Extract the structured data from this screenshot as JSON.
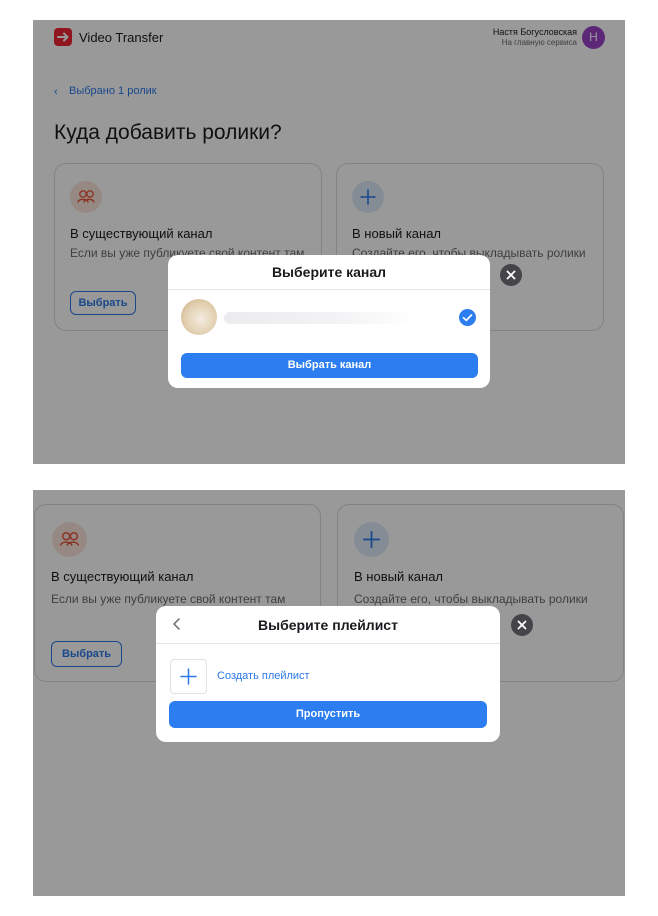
{
  "header": {
    "app_title": "Video Transfer",
    "user_name": "Настя Богусловская",
    "user_link": "На главную сервиса",
    "avatar_letter": "Н",
    "avatar_color": "#9c42c7",
    "logo_color": "#ee2533"
  },
  "breadcrumb": {
    "back_label": "Выбрано 1 ролик"
  },
  "page": {
    "title": "Куда добавить ролики?"
  },
  "cards": {
    "existing": {
      "title": "В существующий канал",
      "description": "Если вы уже публикуете свой контент там",
      "button": "Выбрать",
      "icon": "users-icon",
      "icon_color": "#e8583c"
    },
    "new": {
      "title": "В новый канал",
      "description": "Создайте его, чтобы выкладывать ролики",
      "icon": "plus-icon",
      "icon_color": "#2b78e8"
    }
  },
  "channel_modal": {
    "title": "Выберите канал",
    "select_button": "Выбрать канал",
    "selected": true
  },
  "playlist_modal": {
    "title": "Выберите плейлист",
    "create_label": "Создать плейлист",
    "skip_button": "Пропустить"
  },
  "colors": {
    "accent": "#2b7df0",
    "overlay": "rgba(0,0,0,0.40)"
  }
}
